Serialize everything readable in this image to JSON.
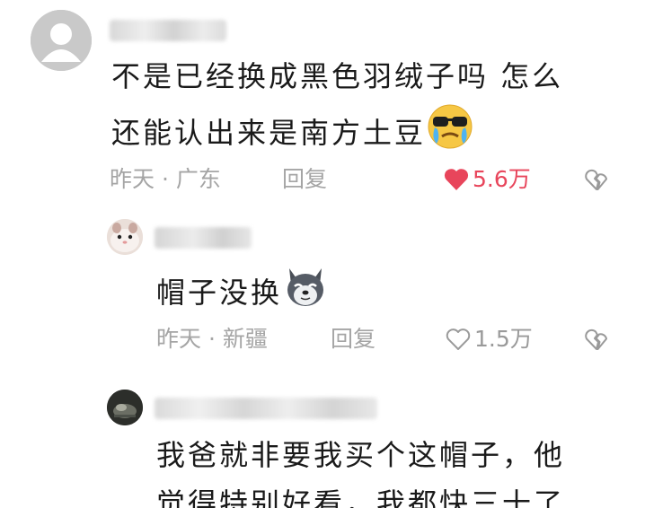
{
  "comments": [
    {
      "avatar": "default-user-avatar",
      "text_lines": [
        "不是已经换成黑色羽绒子吗 怎么",
        "还能认出来是南方土豆"
      ],
      "emoji": "sunglasses-crying-emoji",
      "time_location": "昨天 · 广东",
      "reply_label": "回复",
      "likes": "5.6万",
      "liked": true
    },
    {
      "avatar": "hamster-avatar",
      "text_lines": [
        "帽子没换"
      ],
      "emoji": "husky-emoji",
      "time_location": "昨天 · 新疆",
      "reply_label": "回复",
      "likes": "1.5万",
      "liked": false
    },
    {
      "avatar": "dark-photo-avatar",
      "text_lines": [
        "我爸就非要我买个这帽子，他",
        "觉得特别好看，我都快三十了"
      ]
    }
  ],
  "colors": {
    "text": "#1a1a1a",
    "meta": "#a5a5a5",
    "liked": "#e8455b"
  },
  "icons": [
    "heart-icon",
    "broken-heart-icon"
  ]
}
